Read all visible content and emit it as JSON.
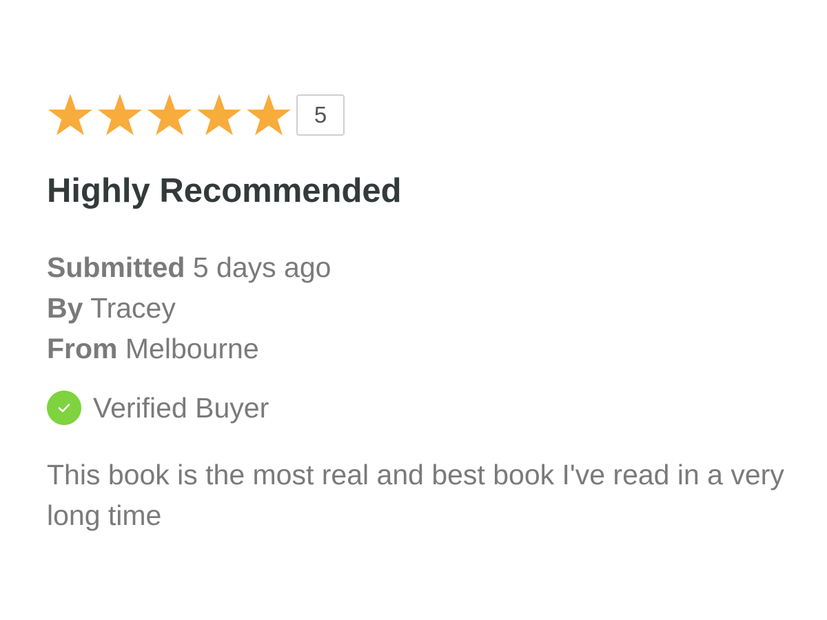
{
  "review": {
    "rating": {
      "value": 5,
      "max": 5,
      "display": "5",
      "star_color": "#f7ac3b"
    },
    "title": "Highly Recommended",
    "submitted": {
      "label": "Submitted",
      "value": "5 days ago"
    },
    "author": {
      "label": "By",
      "value": "Tracey"
    },
    "location": {
      "label": "From",
      "value": "Melbourne"
    },
    "verified": {
      "icon": "check-circle-icon",
      "label": "Verified Buyer",
      "color": "#7ed33f"
    },
    "body": "This book is the most real and best book I've read in a very long time"
  }
}
